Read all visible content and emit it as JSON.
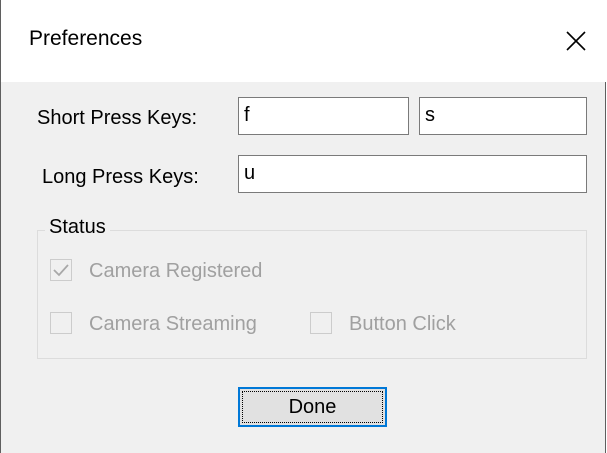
{
  "window": {
    "title": "Preferences",
    "close_icon": "close-icon"
  },
  "keys": {
    "short_press_label": "Short Press Keys:",
    "short_press_values": [
      "f",
      "s"
    ],
    "long_press_label": "Long Press Keys:",
    "long_press_value": "u"
  },
  "status": {
    "legend": "Status",
    "camera_registered": {
      "label": "Camera Registered",
      "checked": true,
      "enabled": false
    },
    "camera_streaming": {
      "label": "Camera Streaming",
      "checked": false,
      "enabled": false
    },
    "button_click": {
      "label": "Button Click",
      "checked": false,
      "enabled": false
    }
  },
  "actions": {
    "done_label": "Done"
  },
  "colors": {
    "accent": "#0078d7",
    "dialog_background": "#f0f0f0",
    "disabled_text": "#a0a0a0"
  }
}
